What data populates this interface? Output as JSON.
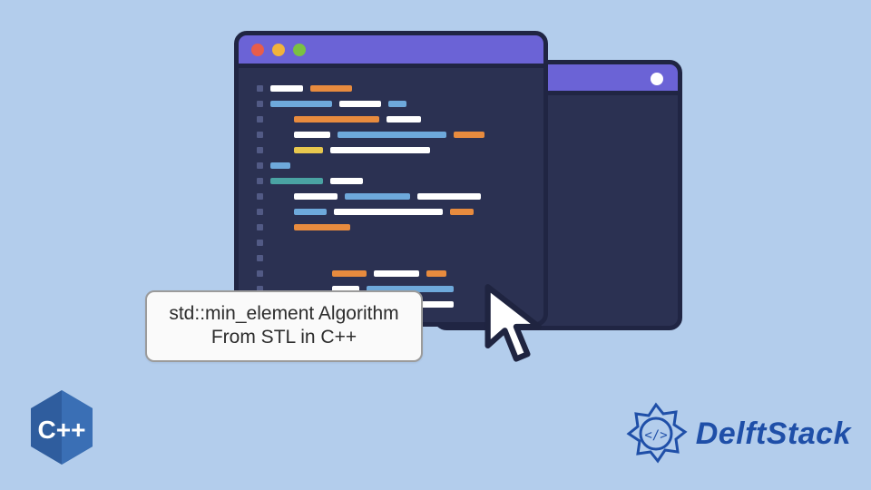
{
  "caption": {
    "line1": "std::min_element Algorithm",
    "line2": "From STL in C++"
  },
  "cpp_badge": {
    "text": "C++"
  },
  "brand": {
    "name": "DelftStack"
  },
  "colors": {
    "page_bg": "#b3cdec",
    "window_body": "#2b3152",
    "window_border": "#202543",
    "titlebar": "#6b63d6",
    "code_white": "#ffffff",
    "code_orange": "#e88b3e",
    "code_blue": "#6ea9db",
    "code_yellow": "#e8c84e",
    "code_teal": "#4aa3a3",
    "brand_blue": "#1f4fa8",
    "cpp_blue": "#2f5d9e"
  },
  "icons": {
    "traffic_light_red": "traffic-light-red-icon",
    "traffic_light_yellow": "traffic-light-yellow-icon",
    "traffic_light_green": "traffic-light-green-icon",
    "window_dot": "window-dot-icon",
    "cursor": "cursor-arrow-icon",
    "cpp": "cpp-hex-icon",
    "delft_mark": "delftstack-mark-icon"
  }
}
